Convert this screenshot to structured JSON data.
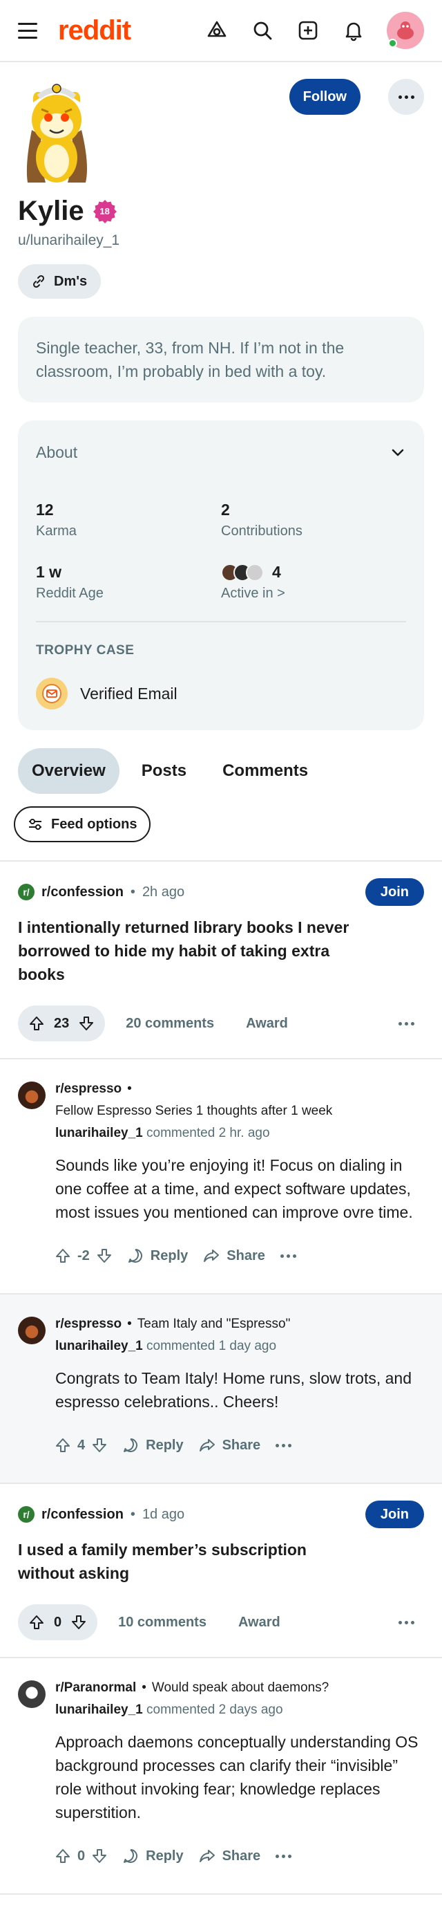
{
  "brand": {
    "logo_text": "reddit",
    "accent": "#ff4500",
    "follow_color": "#0a449b"
  },
  "header_icons": [
    "menu-icon",
    "ai-icon",
    "search-icon",
    "create-post-icon",
    "notifications-icon",
    "user-avatar"
  ],
  "profile": {
    "display_name": "Kylie",
    "nsfw_badge": "18",
    "username": "u/lunarihailey_1",
    "follow_label": "Follow",
    "link_label": "Dm's",
    "bio": "Single teacher, 33, from NH. If I’m not in the classroom, I’m probably in bed with a toy."
  },
  "about": {
    "title": "About",
    "stats": [
      {
        "value": "12",
        "label": "Karma"
      },
      {
        "value": "2",
        "label": "Contributions"
      },
      {
        "value": "1 w",
        "label": "Reddit Age"
      },
      {
        "value": "4",
        "label": "Active in >"
      }
    ],
    "trophy_title": "TROPHY CASE",
    "trophies": [
      {
        "name": "Verified Email"
      }
    ]
  },
  "tabs": [
    {
      "label": "Overview",
      "active": true
    },
    {
      "label": "Posts",
      "active": false
    },
    {
      "label": "Comments",
      "active": false
    }
  ],
  "feed_options_label": "Feed options",
  "feed": [
    {
      "kind": "post",
      "subreddit": "r/confession",
      "time": "2h ago",
      "join_label": "Join",
      "title": "I intentionally returned library books I never borrowed to hide my habit of taking extra books",
      "votes": "23",
      "comments": "20 comments",
      "award": "Award"
    },
    {
      "kind": "comment",
      "subreddit": "r/espresso",
      "post_title": "Fellow Espresso Series 1 thoughts after 1 week",
      "user": "lunarihailey_1",
      "action": "commented",
      "time": "2 hr. ago",
      "text": "Sounds like you’re enjoying it! Focus on dialing in one coffee at a time, and expect software updates, most issues you mentioned can improve ovre time.",
      "votes": "-2",
      "reply": "Reply",
      "share": "Share"
    },
    {
      "kind": "comment",
      "subreddit": "r/espresso",
      "post_title": "Team Italy and \"Espresso\"",
      "user": "lunarihailey_1",
      "action": "commented",
      "time": "1 day ago",
      "text": "Congrats to Team Italy! Home runs, slow trots, and espresso celebrations.. Cheers!",
      "votes": "4",
      "reply": "Reply",
      "share": "Share"
    },
    {
      "kind": "post",
      "subreddit": "r/confession",
      "time": "1d ago",
      "join_label": "Join",
      "title": "I used a family member’s subscription without asking",
      "votes": "0",
      "comments": "10 comments",
      "award": "Award"
    },
    {
      "kind": "comment",
      "subreddit": "r/Paranormal",
      "post_title": "Would speak about daemons?",
      "user": "lunarihailey_1",
      "action": "commented",
      "time": "2 days ago",
      "text": "Approach daemons conceptually understanding OS background processes can clarify their “invisible” role without invoking fear; knowledge replaces superstition.",
      "votes": "0",
      "reply": "Reply",
      "share": "Share"
    }
  ]
}
